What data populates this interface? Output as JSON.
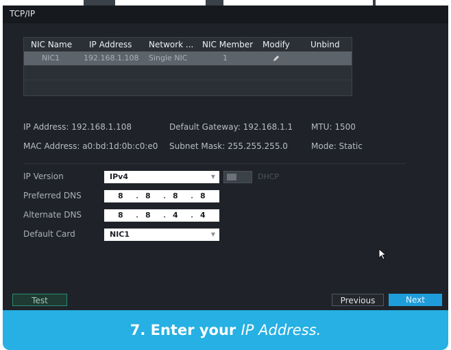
{
  "window": {
    "title": "TCP/IP"
  },
  "nic_table": {
    "headers": [
      "NIC Name",
      "IP Address",
      "Network ...",
      "NIC Member",
      "Modify",
      "Unbind"
    ],
    "rows": [
      {
        "nic_name": "NIC1",
        "ip_address": "192.168.1.108",
        "network": "Single NIC",
        "nic_member": "1",
        "modify_icon": "pencil-icon"
      }
    ]
  },
  "info": {
    "ip_address": "IP Address: 192.168.1.108",
    "default_gateway": "Default Gateway: 192.168.1.1",
    "mtu": "MTU: 1500",
    "mac_address": "MAC Address: a0:bd:1d:0b:c0:e0",
    "subnet_mask": "Subnet Mask: 255.255.255.0",
    "mode": "Mode: Static"
  },
  "form": {
    "ip_version": {
      "label": "IP Version",
      "value": "IPv4"
    },
    "dhcp": {
      "label": "DHCP",
      "enabled": false
    },
    "preferred_dns": {
      "label": "Preferred DNS",
      "octets": [
        "8",
        "8",
        "8",
        "8"
      ]
    },
    "alternate_dns": {
      "label": "Alternate DNS",
      "octets": [
        "8",
        "8",
        "4",
        "4"
      ]
    },
    "default_card": {
      "label": "Default Card",
      "value": "NIC1"
    }
  },
  "buttons": {
    "test": "Test",
    "previous": "Previous",
    "next": "Next"
  },
  "caption": {
    "step": "7. Enter your",
    "emphasis": "IP Address."
  },
  "colors": {
    "accent": "#1f9ddb",
    "frame": "#26b0e3",
    "window_bg": "#1f2329"
  }
}
